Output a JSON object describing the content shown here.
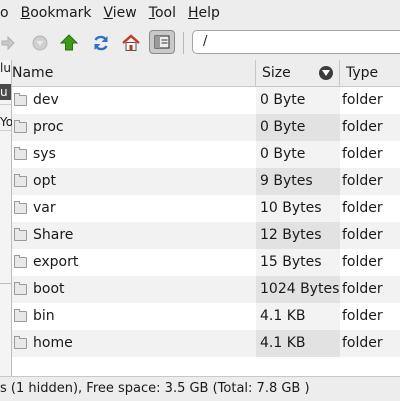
{
  "menubar": {
    "items": [
      {
        "label": "o",
        "key": "",
        "rest": ""
      },
      {
        "label": "Bookmark",
        "key": "B",
        "rest": "ookmark"
      },
      {
        "label": "View",
        "key": "V",
        "rest": "iew"
      },
      {
        "label": "Tool",
        "key": "T",
        "rest": "ool"
      },
      {
        "label": "Help",
        "key": "H",
        "rest": "elp"
      }
    ]
  },
  "toolbar": {
    "path": "/"
  },
  "sidebar": {
    "fragments": [
      "lu",
      "u",
      "Yo"
    ]
  },
  "table": {
    "columns": {
      "name": "Name",
      "size": "Size",
      "type": "Type"
    },
    "rows": [
      {
        "name": "dev",
        "size": "0 Byte",
        "type": "folder"
      },
      {
        "name": "proc",
        "size": "0 Byte",
        "type": "folder"
      },
      {
        "name": "sys",
        "size": "0 Byte",
        "type": "folder"
      },
      {
        "name": "opt",
        "size": "9 Bytes",
        "type": "folder"
      },
      {
        "name": "var",
        "size": "10 Bytes",
        "type": "folder"
      },
      {
        "name": "Share",
        "size": "12 Bytes",
        "type": "folder"
      },
      {
        "name": "export",
        "size": "15 Bytes",
        "type": "folder"
      },
      {
        "name": "boot",
        "size": "1024 Bytes",
        "type": "folder"
      },
      {
        "name": "bin",
        "size": "4.1 KB",
        "type": "folder"
      },
      {
        "name": "home",
        "size": "4.1 KB",
        "type": "folder"
      }
    ]
  },
  "status": {
    "text": "s (1 hidden), Free space: 3.5 GB (Total: 7.8 GB )"
  },
  "colors": {
    "up_arrow": "#3d9a1a",
    "refresh": "#2f6fc4",
    "home_roof": "#c0392b"
  }
}
